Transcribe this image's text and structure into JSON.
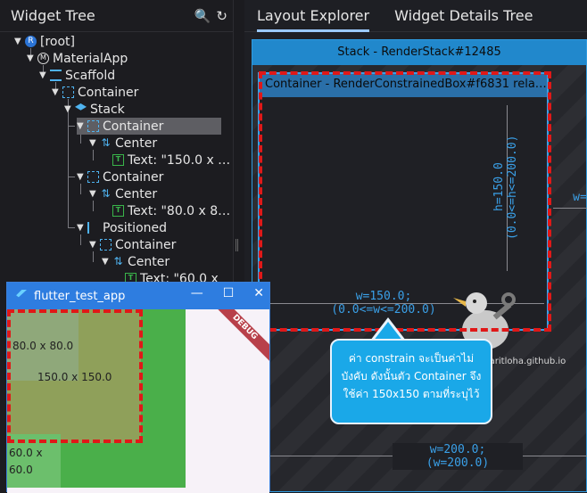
{
  "left_panel": {
    "title": "Widget Tree",
    "icons": [
      "search-icon",
      "refresh-icon"
    ],
    "tree": [
      {
        "label": "[root]",
        "icon": "root-icon"
      },
      {
        "label": "MaterialApp",
        "icon": "material-icon"
      },
      {
        "label": "Scaffold",
        "icon": "scaffold-icon"
      },
      {
        "label": "Container",
        "icon": "container-icon"
      },
      {
        "label": "Stack",
        "icon": "stack-icon"
      },
      {
        "label": "Container",
        "icon": "container-icon",
        "selected": true
      },
      {
        "label": "Center",
        "icon": "center-icon"
      },
      {
        "label": "Text: \"150.0 x …",
        "icon": "text-icon"
      },
      {
        "label": "Container",
        "icon": "container-icon"
      },
      {
        "label": "Center",
        "icon": "center-icon"
      },
      {
        "label": "Text: \"80.0 x 8…",
        "icon": "text-icon"
      },
      {
        "label": "Positioned",
        "icon": "positioned-icon"
      },
      {
        "label": "Container",
        "icon": "container-icon"
      },
      {
        "label": "Center",
        "icon": "center-icon"
      },
      {
        "label": "Text: \"60.0 x",
        "icon": "text-icon"
      }
    ]
  },
  "right_panel": {
    "tabs": [
      {
        "label": "Layout Explorer",
        "active": true
      },
      {
        "label": "Widget Details Tree",
        "active": false
      }
    ],
    "stack_label": "Stack - RenderStack#12485",
    "container_label": "Container - RenderConstrainedBox#f6831 rela…",
    "height_measure": "h=150.0\n(0.0<=h<=200.0)",
    "width_measure": "w=150.0;\n(0.0<=w<=200.0)",
    "right_measure": "w=",
    "bottom_measure": "w=200.0;\n(w=200.0)",
    "watermark": "hawaritloha.github.io",
    "callout": "ค่า constrain จะเป็นค่าไม่บังคับ ดังนั้นตัว Container จึงใช้ค่า 150x150 ตามที่ระบุไว้"
  },
  "app_window": {
    "title": "flutter_test_app",
    "controls": [
      "minimize-icon",
      "maximize-icon",
      "close-icon"
    ],
    "debug_banner": "DEBUG",
    "label_80": "80.0 x 80.0",
    "label_150": "150.0 x 150.0",
    "label_60": "60.0 x\n60.0"
  },
  "colors": {
    "accent": "#2f9be0",
    "highlight_red": "#e01818",
    "callout_bg": "#1aa8e8",
    "app_green": "#4aaf4a"
  }
}
